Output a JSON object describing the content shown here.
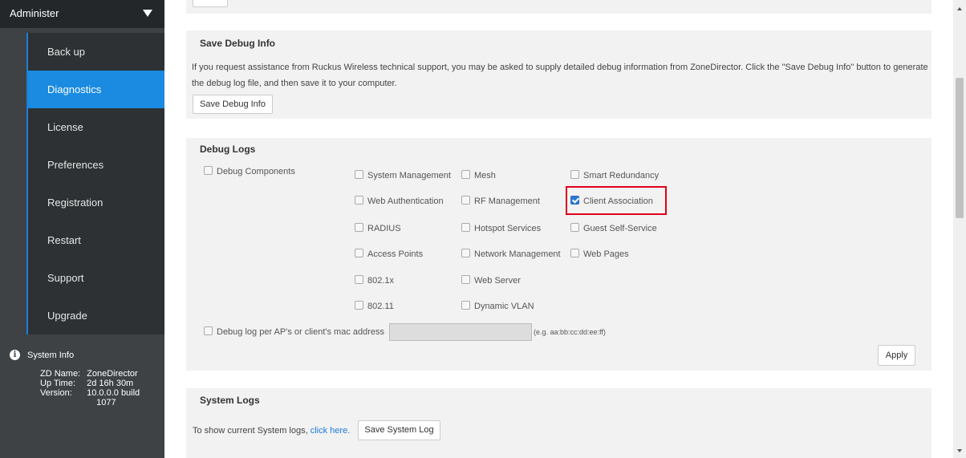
{
  "sidebar": {
    "header": "Administer",
    "items": [
      {
        "label": "Back up",
        "active": false
      },
      {
        "label": "Diagnostics",
        "active": true
      },
      {
        "label": "License",
        "active": false
      },
      {
        "label": "Preferences",
        "active": false
      },
      {
        "label": "Registration",
        "active": false
      },
      {
        "label": "Restart",
        "active": false
      },
      {
        "label": "Support",
        "active": false
      },
      {
        "label": "Upgrade",
        "active": false
      }
    ],
    "system_info": {
      "title": "System Info",
      "zd_name_label": "ZD Name:",
      "zd_name": "ZoneDirector",
      "uptime_label": "Up Time:",
      "uptime": "2d 16h 30m",
      "version_label": "Version:",
      "version_line1": "10.0.0.0 build",
      "version_line2": "1077"
    }
  },
  "save_debug_info": {
    "title": "Save Debug Info",
    "description": "If you request assistance from Ruckus Wireless technical support, you may be asked to supply detailed debug information from ZoneDirector. Click the \"Save Debug Info\" button to generate the debug log file, and then save it to your computer.",
    "button": "Save Debug Info"
  },
  "debug_logs": {
    "title": "Debug Logs",
    "debug_components_label": "Debug Components",
    "components": [
      {
        "label": "System Management",
        "checked": false
      },
      {
        "label": "Mesh",
        "checked": false
      },
      {
        "label": "Smart Redundancy",
        "checked": false
      },
      {
        "label": "Web Authentication",
        "checked": false
      },
      {
        "label": "RF Management",
        "checked": false
      },
      {
        "label": "Client Association",
        "checked": true
      },
      {
        "label": "RADIUS",
        "checked": false
      },
      {
        "label": "Hotspot Services",
        "checked": false
      },
      {
        "label": "Guest Self-Service",
        "checked": false
      },
      {
        "label": "Access Points",
        "checked": false
      },
      {
        "label": "Network Management",
        "checked": false
      },
      {
        "label": "Web Pages",
        "checked": false
      },
      {
        "label": "802.1x",
        "checked": false
      },
      {
        "label": "Web Server",
        "checked": false
      },
      {
        "label": "802.11",
        "checked": false
      },
      {
        "label": "Dynamic VLAN",
        "checked": false
      }
    ],
    "mac_label": "Debug log per AP's or client's mac address",
    "mac_value": "",
    "mac_hint": "(e.g. aa:bb:cc:dd:ee:ff)",
    "apply_button": "Apply"
  },
  "system_logs": {
    "title": "System Logs",
    "text": "To show current System logs,",
    "link": "click here.",
    "button": "Save System Log"
  },
  "colors": {
    "sidebar_bg": "#3e4245",
    "active_item": "#1a8be0",
    "highlight": "#e0001b",
    "link": "#1a7ad6"
  }
}
